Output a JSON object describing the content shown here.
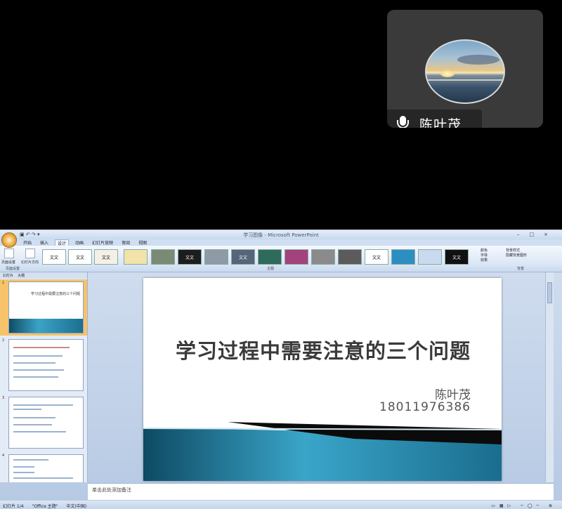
{
  "participant": {
    "name": "陈叶茂",
    "avatar_icon": "sunset-ocean-avatar",
    "mic_icon": "microphone-icon"
  },
  "ppt": {
    "window_title": "学习图像 - Microsoft PowerPoint",
    "tabs": [
      {
        "label": "开始"
      },
      {
        "label": "插入"
      },
      {
        "label": "设计"
      },
      {
        "label": "动画"
      },
      {
        "label": "幻灯片放映"
      },
      {
        "label": "审阅"
      },
      {
        "label": "视图"
      }
    ],
    "active_tab_index": 2,
    "ribbon": {
      "page_setup_label": "页面设置",
      "orientation_label": "幻灯片方向",
      "page_setup_group": "页面设置",
      "themes_group": "主题",
      "background_group": "背景",
      "colors_label": "颜色",
      "fonts_label": "字体",
      "effects_label": "效果",
      "bg_styles_label": "背景样式",
      "hide_bg_label": "隐藏背景图形",
      "theme_sample": "文文"
    },
    "panel_tabs": {
      "slides": "幻灯片",
      "outline": "大纲"
    },
    "thumbnails": [
      {
        "num": "1",
        "text": "学习过程中需要注意的三个问题"
      },
      {
        "num": "2",
        "text": ""
      },
      {
        "num": "3",
        "text": ""
      },
      {
        "num": "4",
        "text": ""
      }
    ],
    "slide": {
      "title": "学习过程中需要注意的三个问题",
      "author": "陈叶茂",
      "phone": "18011976386"
    },
    "notes_placeholder": "单击此处添加备注",
    "status": {
      "slide_info": "幻灯片 1/4",
      "theme": "\"Office 主题\"",
      "language": "中文(中国)"
    }
  }
}
